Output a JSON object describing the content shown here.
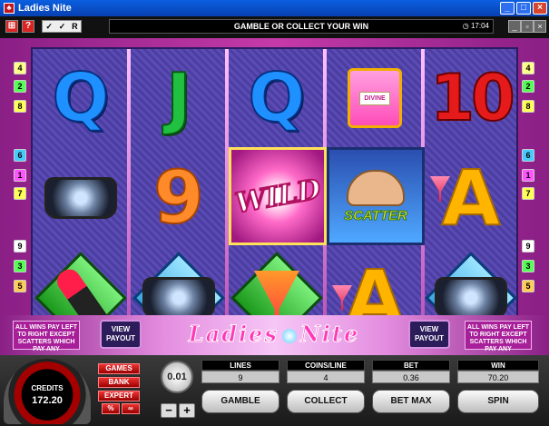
{
  "window": {
    "title": "Ladies Nite"
  },
  "toolbar": {
    "icon_1": "⊞",
    "icon_2": "?",
    "tools": [
      "✓",
      "✓",
      "R"
    ],
    "message": "GAMBLE OR COLLECT YOUR WIN",
    "clock": "17:04"
  },
  "paylines": {
    "left": [
      "4",
      "2",
      "8",
      "6",
      "1",
      "7",
      "9",
      "3",
      "5"
    ],
    "right": [
      "4",
      "2",
      "8",
      "6",
      "1",
      "7",
      "9",
      "3",
      "5"
    ]
  },
  "reels": {
    "row1": [
      "Q",
      "J",
      "Q",
      "perfume",
      "10"
    ],
    "row2": [
      "purse",
      "9",
      "WILD",
      "SCATTER",
      "A"
    ],
    "row3": [
      "lipstick",
      "purse",
      "cocktail",
      "A",
      "purse"
    ],
    "perfume_label": "DIVINE",
    "wild_text": "WILD",
    "scatter_text": "SCATTER"
  },
  "banner": {
    "info_left": "ALL WINS PAY LEFT TO RIGHT EXCEPT SCATTERS WHICH PAY ANY",
    "view_payout": "VIEW PAYOUT",
    "logo_left": "Ladies",
    "logo_right": "Nite",
    "info_right": "ALL WINS PAY LEFT TO RIGHT EXCEPT SCATTERS WHICH PAY ANY"
  },
  "console": {
    "credits_label": "CREDITS",
    "credits_value": "172.20",
    "modes": [
      "GAMES",
      "BANK",
      "EXPERT"
    ],
    "small": [
      "%",
      "∞"
    ],
    "coin_value": "0.01",
    "minus": "−",
    "plus": "+",
    "lines_label": "LINES",
    "lines_value": "9",
    "coins_label": "COINS/LINE",
    "coins_value": "4",
    "bet_label": "BET",
    "bet_value": "0.36",
    "win_label": "WIN",
    "win_value": "70.20",
    "gamble": "GAMBLE",
    "collect": "COLLECT",
    "betmax": "BET MAX",
    "spin": "SPIN"
  },
  "colors": {
    "frame": "#c53aa8",
    "reel_bg": "#4a3fa0",
    "title_blue": "#0a5fe0"
  }
}
